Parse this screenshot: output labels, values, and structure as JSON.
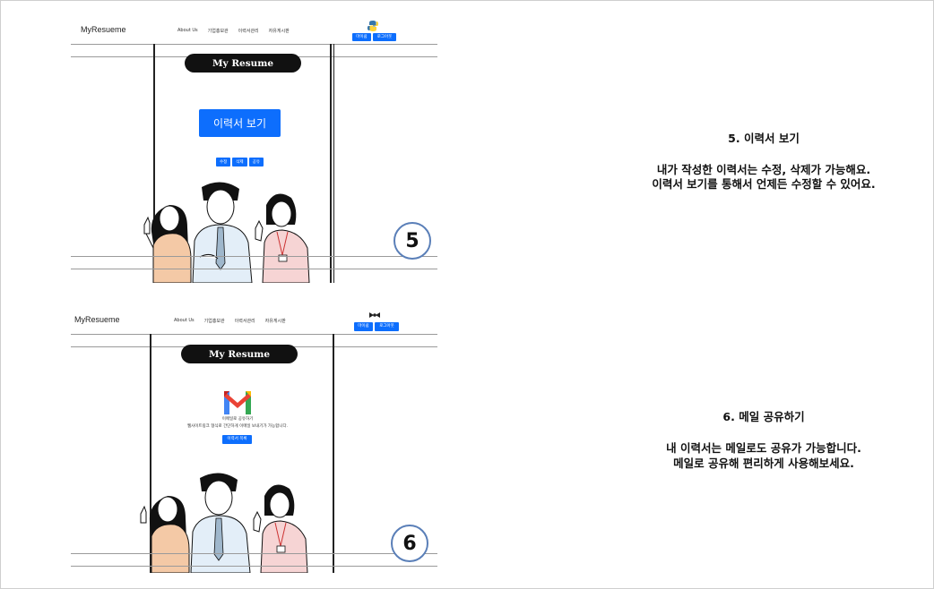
{
  "slides": [
    {
      "logo": "MyResueme",
      "nav": [
        "About Us",
        "기업홍보관",
        "이력서관리",
        "자유게시판"
      ],
      "auth_buttons": [
        "마이쉽",
        "로그아웃"
      ],
      "banner_title": "My Resume",
      "main_button": "이력서 보기",
      "action_buttons": [
        "수정",
        "삭제",
        "공유"
      ],
      "badge_number": "5",
      "caption_title": "5. 이력서 보기",
      "caption_lines": [
        "내가 작성한 이력서는 수정, 삭제가 가능해요.",
        "이력서 보기를 통해서 언제든 수정할 수 있어요."
      ]
    },
    {
      "logo": "MyResueme",
      "nav": [
        "About Us",
        "기업홍보관",
        "이력서관리",
        "자유게시판"
      ],
      "auth_buttons": [
        "마이쉽",
        "로그아웃"
      ],
      "banner_title": "My Resume",
      "mail_title": "이메일로 공유하기",
      "mail_desc": "웹사이트링크 형식로 간단하게 이메일 보내기가 가능합니다.",
      "mail_button": "이력서 목록",
      "badge_number": "6",
      "caption_title": "6. 메일 공유하기",
      "caption_lines": [
        "내 이력서는 메일로도 공유가 가능합니다.",
        "메일로 공유해 편리하게 사용해보세요."
      ]
    }
  ],
  "colors": {
    "accent": "#0d6efd",
    "badge_border": "#5a7fb8"
  }
}
